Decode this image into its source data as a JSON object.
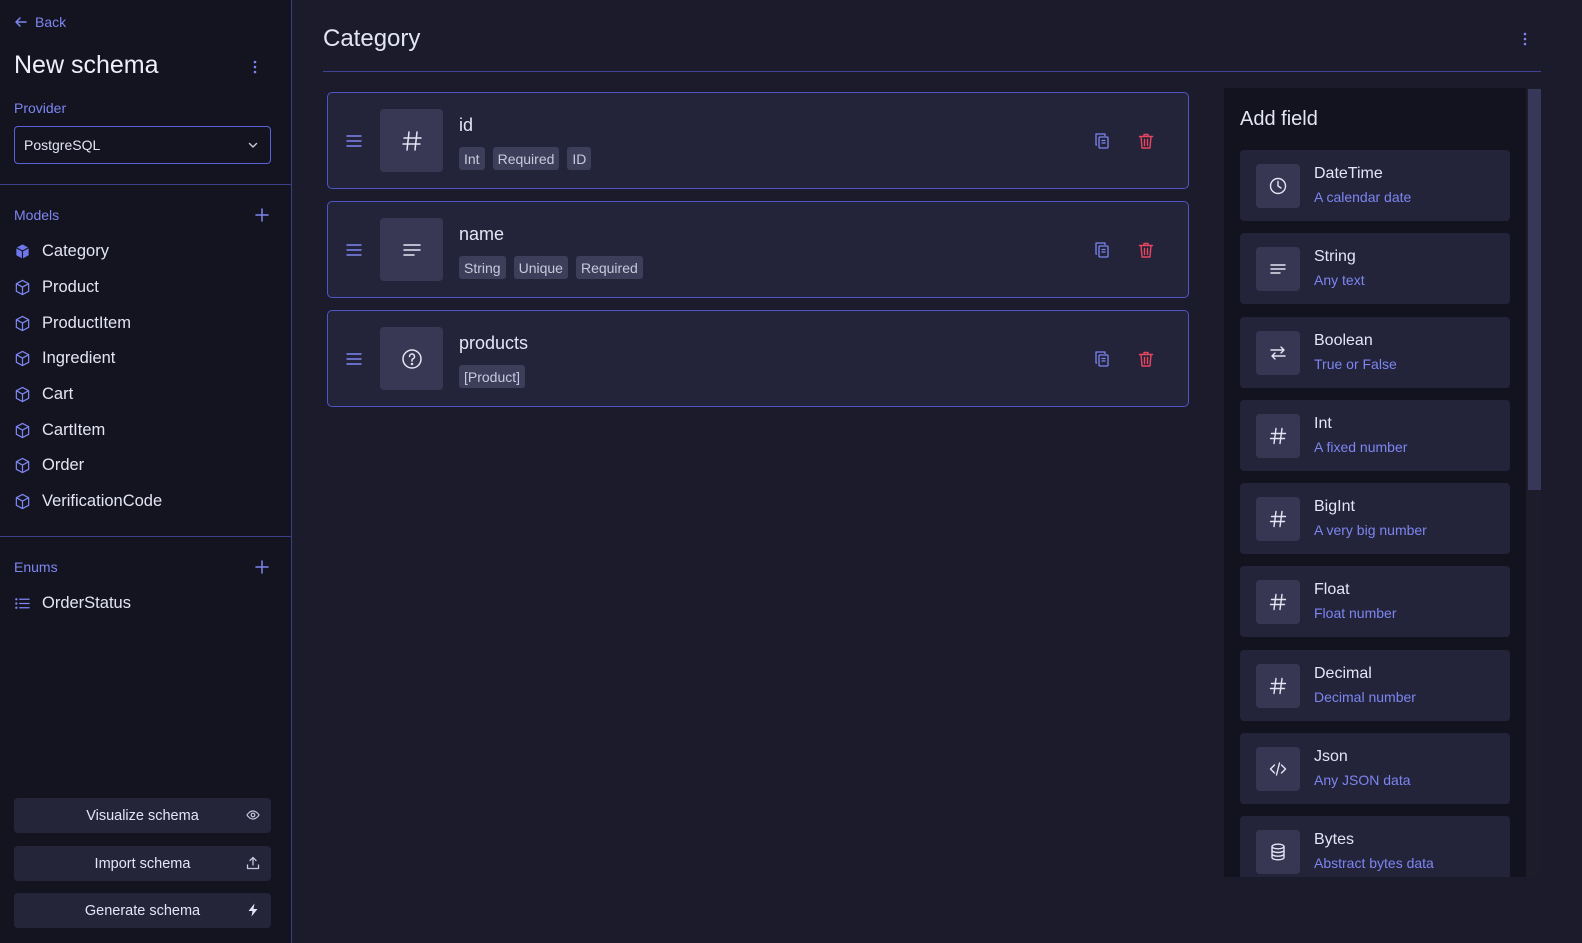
{
  "sidebar": {
    "back_label": "Back",
    "schema_title": "New schema",
    "provider_label": "Provider",
    "provider_value": "PostgreSQL",
    "models_label": "Models",
    "models": [
      {
        "label": "Category",
        "icon": "cube-filled-icon",
        "active": true
      },
      {
        "label": "Product",
        "icon": "cube-icon"
      },
      {
        "label": "ProductItem",
        "icon": "cube-icon"
      },
      {
        "label": "Ingredient",
        "icon": "cube-icon"
      },
      {
        "label": "Cart",
        "icon": "cube-icon"
      },
      {
        "label": "CartItem",
        "icon": "cube-icon"
      },
      {
        "label": "Order",
        "icon": "cube-icon"
      },
      {
        "label": "VerificationCode",
        "icon": "cube-icon"
      }
    ],
    "enums_label": "Enums",
    "enums": [
      {
        "label": "OrderStatus",
        "icon": "list-icon"
      }
    ],
    "buttons": {
      "visualize": "Visualize schema",
      "import": "Import schema",
      "generate": "Generate schema"
    }
  },
  "main": {
    "title": "Category",
    "fields": [
      {
        "name": "id",
        "type_icon": "hash-icon",
        "tags": [
          "Int",
          "Required",
          "ID"
        ]
      },
      {
        "name": "name",
        "type_icon": "text-lines-icon",
        "tags": [
          "String",
          "Unique",
          "Required"
        ]
      },
      {
        "name": "products",
        "type_icon": "question-circle-icon",
        "tags": [
          "[Product]"
        ]
      }
    ]
  },
  "add_field": {
    "title": "Add field",
    "types": [
      {
        "name": "DateTime",
        "desc": "A calendar date",
        "icon": "clock-icon"
      },
      {
        "name": "String",
        "desc": "Any text",
        "icon": "text-lines-icon"
      },
      {
        "name": "Boolean",
        "desc": "True or False",
        "icon": "swap-arrows-icon"
      },
      {
        "name": "Int",
        "desc": "A fixed number",
        "icon": "hash-icon"
      },
      {
        "name": "BigInt",
        "desc": "A very big number",
        "icon": "hash-icon"
      },
      {
        "name": "Float",
        "desc": "Float number",
        "icon": "hash-icon"
      },
      {
        "name": "Decimal",
        "desc": "Decimal number",
        "icon": "hash-icon"
      },
      {
        "name": "Json",
        "desc": "Any JSON data",
        "icon": "code-icon"
      },
      {
        "name": "Bytes",
        "desc": "Abstract bytes data",
        "icon": "database-icon"
      }
    ]
  },
  "colors": {
    "accent": "#7d86f0",
    "danger": "#e8455f",
    "sidebar_bg": "#141421",
    "main_bg": "#1b1b2c",
    "card_bg": "#23233a"
  }
}
